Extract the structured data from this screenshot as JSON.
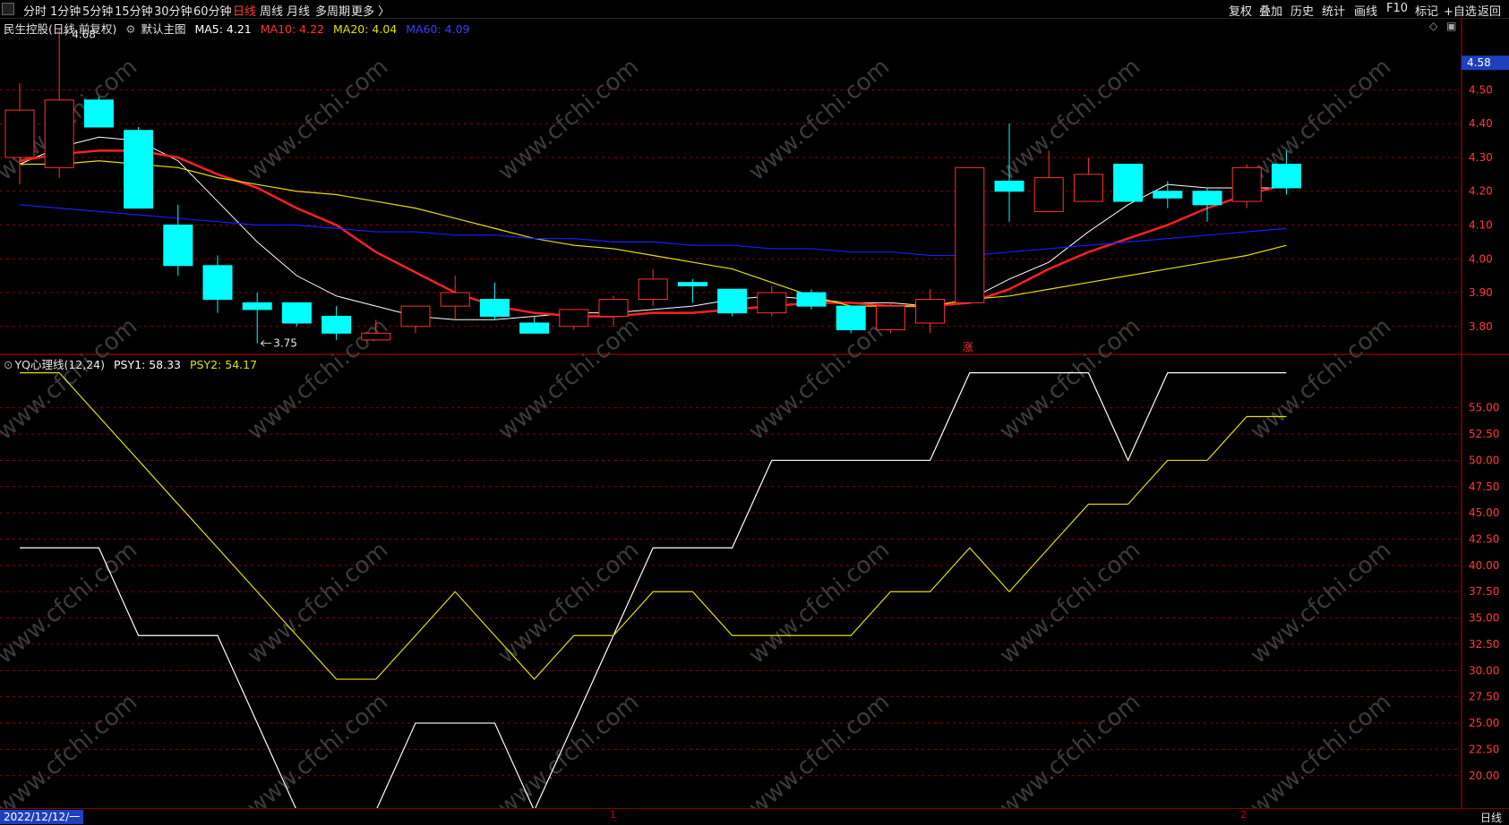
{
  "toolbar": {
    "left_items": [
      "分时",
      "1分钟",
      "5分钟",
      "15分钟",
      "30分钟",
      "60分钟",
      "日线",
      "周线",
      "月线",
      "多周期",
      "更多 〉"
    ],
    "active_index": 6,
    "right_items": [
      "复权",
      "叠加",
      "历史",
      "统计",
      "画线",
      "F10",
      "标记",
      "+自选",
      "返回"
    ]
  },
  "main_legend": {
    "stock": "民生控股",
    "mode": "(日线,前复权)",
    "template": "默认主图",
    "ma5": "MA5: 4.21",
    "ma10": "MA10: 4.22",
    "ma20": "MA20: 4.04",
    "ma60": "MA60: 4.09"
  },
  "sub_legend": {
    "name": "YQ心理线(12,24)",
    "psy1": "PSY1: 58.33",
    "psy2": "PSY2: 54.17"
  },
  "colors": {
    "up": "#ff3232",
    "down": "#00ffff",
    "ma5": "#ffffff",
    "ma10": "#ff2020",
    "ma20": "#e0e000",
    "ma60": "#1a1aff",
    "psy1": "#ffffff",
    "psy2": "#e0e000",
    "grid": "#8b0000",
    "axis_text": "#ff3b3b"
  },
  "annotations": {
    "high_label": "4.68",
    "low_label": "3.75",
    "current_price": "4.58",
    "rise_mark": "涨",
    "watermark": "www.cfchi.com"
  },
  "bottom": {
    "date": "2022/12/12/一",
    "period": "日线",
    "marks": [
      "1",
      "2"
    ]
  },
  "chart_data": [
    {
      "type": "candlestick",
      "title": "民生控股",
      "ylim": [
        3.72,
        4.66
      ],
      "yticks": [
        3.8,
        3.9,
        4.0,
        4.1,
        4.2,
        4.3,
        4.4,
        4.5
      ],
      "candles": [
        {
          "o": 4.3,
          "h": 4.52,
          "l": 4.22,
          "c": 4.44
        },
        {
          "o": 4.27,
          "h": 4.68,
          "l": 4.24,
          "c": 4.47
        },
        {
          "o": 4.47,
          "h": 4.48,
          "l": 4.39,
          "c": 4.39
        },
        {
          "o": 4.38,
          "h": 4.39,
          "l": 4.15,
          "c": 4.15
        },
        {
          "o": 4.1,
          "h": 4.16,
          "l": 3.95,
          "c": 3.98
        },
        {
          "o": 3.98,
          "h": 4.01,
          "l": 3.84,
          "c": 3.88
        },
        {
          "o": 3.87,
          "h": 3.9,
          "l": 3.75,
          "c": 3.85
        },
        {
          "o": 3.87,
          "h": 3.87,
          "l": 3.8,
          "c": 3.81
        },
        {
          "o": 3.83,
          "h": 3.86,
          "l": 3.76,
          "c": 3.78
        },
        {
          "o": 3.76,
          "h": 3.82,
          "l": 3.76,
          "c": 3.78
        },
        {
          "o": 3.8,
          "h": 3.86,
          "l": 3.78,
          "c": 3.86
        },
        {
          "o": 3.86,
          "h": 3.95,
          "l": 3.82,
          "c": 3.9
        },
        {
          "o": 3.88,
          "h": 3.93,
          "l": 3.82,
          "c": 3.83
        },
        {
          "o": 3.81,
          "h": 3.83,
          "l": 3.78,
          "c": 3.78
        },
        {
          "o": 3.8,
          "h": 3.85,
          "l": 3.79,
          "c": 3.85
        },
        {
          "o": 3.83,
          "h": 3.89,
          "l": 3.8,
          "c": 3.88
        },
        {
          "o": 3.88,
          "h": 3.97,
          "l": 3.86,
          "c": 3.94
        },
        {
          "o": 3.93,
          "h": 3.94,
          "l": 3.87,
          "c": 3.92
        },
        {
          "o": 3.91,
          "h": 3.91,
          "l": 3.83,
          "c": 3.84
        },
        {
          "o": 3.84,
          "h": 3.92,
          "l": 3.83,
          "c": 3.9
        },
        {
          "o": 3.9,
          "h": 3.91,
          "l": 3.85,
          "c": 3.86
        },
        {
          "o": 3.86,
          "h": 3.86,
          "l": 3.78,
          "c": 3.79
        },
        {
          "o": 3.79,
          "h": 3.87,
          "l": 3.78,
          "c": 3.86
        },
        {
          "o": 3.81,
          "h": 3.91,
          "l": 3.78,
          "c": 3.88
        },
        {
          "o": 3.87,
          "h": 4.27,
          "l": 3.87,
          "c": 4.27
        },
        {
          "o": 4.23,
          "h": 4.4,
          "l": 4.11,
          "c": 4.2
        },
        {
          "o": 4.14,
          "h": 4.32,
          "l": 4.14,
          "c": 4.24
        },
        {
          "o": 4.17,
          "h": 4.3,
          "l": 4.17,
          "c": 4.25
        },
        {
          "o": 4.28,
          "h": 4.28,
          "l": 4.17,
          "c": 4.17
        },
        {
          "o": 4.2,
          "h": 4.23,
          "l": 4.15,
          "c": 4.18
        },
        {
          "o": 4.2,
          "h": 4.21,
          "l": 4.11,
          "c": 4.16
        },
        {
          "o": 4.17,
          "h": 4.28,
          "l": 4.15,
          "c": 4.27
        },
        {
          "o": 4.28,
          "h": 4.32,
          "l": 4.19,
          "c": 4.21
        }
      ],
      "series": [
        {
          "name": "MA5",
          "values": [
            4.28,
            4.33,
            4.36,
            4.35,
            4.29,
            4.17,
            4.05,
            3.95,
            3.89,
            3.86,
            3.83,
            3.82,
            3.82,
            3.83,
            3.84,
            3.84,
            3.85,
            3.86,
            3.88,
            3.89,
            3.88,
            3.87,
            3.87,
            3.86,
            3.88,
            3.94,
            3.99,
            4.08,
            4.16,
            4.22,
            4.21,
            4.21,
            4.21
          ]
        },
        {
          "name": "MA10",
          "values": [
            4.29,
            4.31,
            4.32,
            4.32,
            4.3,
            4.25,
            4.21,
            4.15,
            4.1,
            4.02,
            3.96,
            3.9,
            3.86,
            3.84,
            3.83,
            3.83,
            3.84,
            3.84,
            3.85,
            3.86,
            3.87,
            3.87,
            3.86,
            3.86,
            3.87,
            3.91,
            3.97,
            4.02,
            4.06,
            4.1,
            4.15,
            4.19,
            4.22
          ]
        },
        {
          "name": "MA20",
          "values": [
            4.28,
            4.28,
            4.29,
            4.28,
            4.27,
            4.24,
            4.22,
            4.2,
            4.19,
            4.17,
            4.15,
            4.12,
            4.09,
            4.06,
            4.04,
            4.03,
            4.01,
            3.99,
            3.97,
            3.93,
            3.89,
            3.86,
            3.86,
            3.86,
            3.88,
            3.89,
            3.91,
            3.93,
            3.95,
            3.97,
            3.99,
            4.01,
            4.04
          ]
        },
        {
          "name": "MA60",
          "values": [
            4.16,
            4.15,
            4.14,
            4.13,
            4.12,
            4.11,
            4.1,
            4.1,
            4.09,
            4.08,
            4.08,
            4.07,
            4.07,
            4.06,
            4.06,
            4.05,
            4.05,
            4.04,
            4.04,
            4.03,
            4.03,
            4.02,
            4.02,
            4.01,
            4.01,
            4.02,
            4.03,
            4.04,
            4.05,
            4.06,
            4.07,
            4.08,
            4.09
          ]
        }
      ]
    },
    {
      "type": "line",
      "title": "YQ心理线(12,24)",
      "ylim": [
        17.0,
        60.0
      ],
      "yticks": [
        20.0,
        22.5,
        25.0,
        27.5,
        30.0,
        32.5,
        35.0,
        37.5,
        40.0,
        42.5,
        45.0,
        47.5,
        50.0,
        52.5,
        55.0
      ],
      "series": [
        {
          "name": "PSY1",
          "values": [
            41.67,
            41.67,
            41.67,
            33.33,
            33.33,
            33.33,
            25.0,
            16.67,
            16.67,
            16.67,
            25.0,
            25.0,
            25.0,
            16.67,
            25.0,
            33.33,
            41.67,
            41.67,
            41.67,
            50.0,
            50.0,
            50.0,
            50.0,
            50.0,
            58.33,
            58.33,
            58.33,
            58.33,
            50.0,
            58.33,
            58.33,
            58.33,
            58.33
          ]
        },
        {
          "name": "PSY2",
          "values": [
            58.33,
            58.33,
            54.17,
            50.0,
            45.83,
            41.67,
            37.5,
            33.33,
            29.17,
            29.17,
            33.33,
            37.5,
            33.33,
            29.17,
            33.33,
            33.33,
            37.5,
            37.5,
            33.33,
            33.33,
            33.33,
            33.33,
            37.5,
            37.5,
            41.67,
            37.5,
            41.67,
            45.83,
            45.83,
            50.0,
            50.0,
            54.17,
            54.17
          ]
        }
      ]
    }
  ]
}
